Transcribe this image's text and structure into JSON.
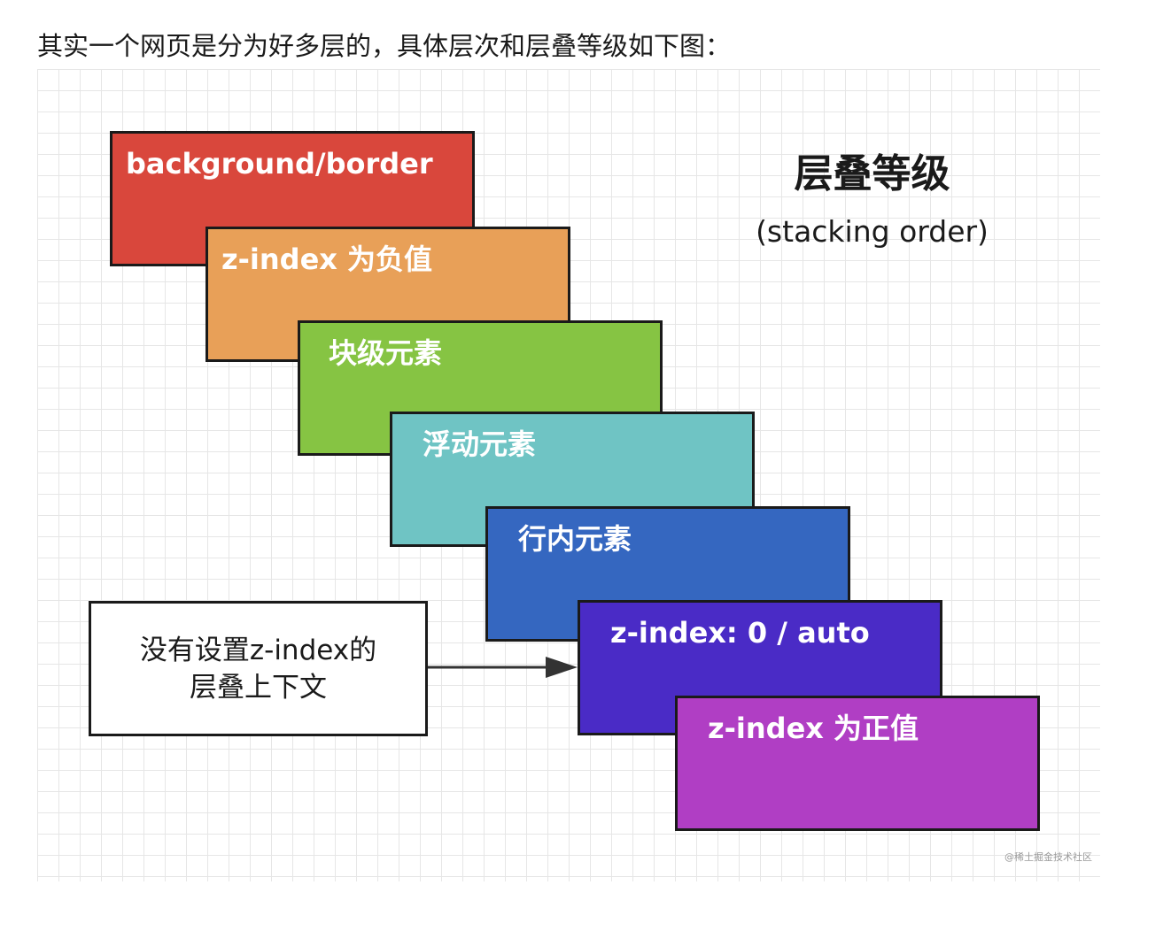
{
  "intro_text": "其实一个网页是分为好多层的，具体层次和层叠等级如下图：",
  "figure": {
    "title": "层叠等级",
    "subtitle": "(stacking order)",
    "layers": [
      {
        "label": "background/border",
        "color": "#d9473c"
      },
      {
        "label": "z-index 为负值",
        "color": "#e8a058"
      },
      {
        "label": "块级元素",
        "color": "#86c443"
      },
      {
        "label": "浮动元素",
        "color": "#6fc4c4"
      },
      {
        "label": "行内元素",
        "color": "#3567c0"
      },
      {
        "label": "z-index: 0 / auto",
        "color": "#4a2bc6"
      },
      {
        "label": "z-index 为正值",
        "color": "#b03ec4"
      }
    ],
    "note_line1": "没有设置z-index的",
    "note_line2": "层叠上下文",
    "watermark": "@稀土掘金技术社区"
  }
}
